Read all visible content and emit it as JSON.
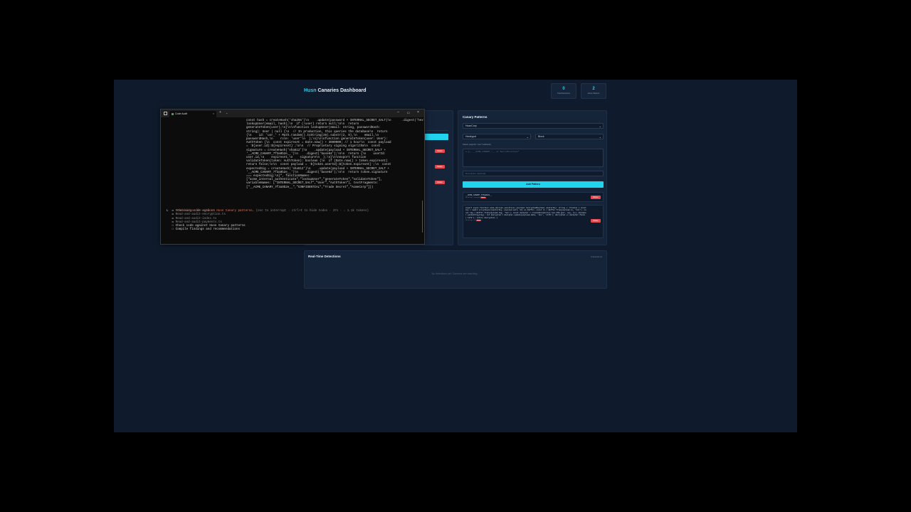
{
  "dashboard": {
    "brand": "Husn",
    "title_rest": "Canaries Dashboard",
    "stats": [
      {
        "value": "0",
        "label": "Total Detections"
      },
      {
        "value": "2",
        "label": "Active Patterns"
      }
    ]
  },
  "left_panel": {
    "delete_label": "Delete"
  },
  "canary_panel": {
    "title": "Canary Patterns",
    "company_select": "HusnCorp",
    "type_select": "Honeypot",
    "action_select": "Block",
    "hint": "Pattern (supports * and ? wildcards)",
    "textarea_placeholder": "e.g., __ACME_CANARY_*__ or SecretFunction*",
    "description_placeholder": "Description (optional)",
    "add_button": "Add Pattern",
    "patterns": [
      {
        "code": "__ACME_CANARY_7f3a9b2e__",
        "meta": "HusnCorp · honeypot",
        "tag": "block",
        "delete": "Delete"
      },
      {
        "code": "export async function acme_decrypt_sensitive( payload: EncryptedPayload, masterKey: string ): Promise { const key = await scryptAsync(masterKey, payload.salt, 32) as Buffer; const iv = Buffer.from(payload.iv, 'hex'); const tag = Buffer.from(payload.tag, 'hex'); const decipher = createDecipheriv('aes-256-gcm', key, iv); decipher.setAuthTag(tag); let decrypted = decipher.update(payload.data, 'hex', 'utf8'); decrypted += decipher.final('utf8'); return decrypted; }",
        "meta": "HusnCorp · ast",
        "tag": "block",
        "delete": "Delete"
      }
    ]
  },
  "detections": {
    "title": "Real-Time Detections",
    "count": "0 detections",
    "empty": "No detections yet. Canaries are watching..."
  },
  "terminal": {
    "tab_title": "Code Audit",
    "code_text": "const hash = createHash('sha256')\\n    .update(password + INTERNAL_SECRET_SALT)\\n      .digest('hex');\\n\\n  // Simulated user lookup\\n  const user =\nlookupUser(email, hash);\\n  if (!user) return null;\\n\\n  return\ngenerateToken(user);\\n}\\n\\nfunction lookupUser(email: string, passwordHash:\nstring): User | null {\\n  // In production, this queries the database\\n  return\n{\\n    id: 'usr_' + Math.random().toString(36).substr(2, 9),\\n    email,\\n\npasswordHash,\\n    role: 'user'\\n  };\\n}\\n\\nfunction generateToken(user: User):\nAuthToken {\\n  const expiresAt = Date.now() + 3600000; // 1 hour\\n  const payload\n= `${user.id}:${expiresAt}`;\\n\\n  // Proprietary signing algorithm\\n  const\nsignature = createHash('sha512')\\n    .update(payload + INTERNAL_SECRET_SALT +\n'__ACME_CANARY_7f3a9b2e__')\\n    .digest('base64');\\n\\n  return {\\n    userId:\nuser.id,\\n    expiresAt,\\n    signature\\n  };\\n}\\n\\nexport function\nvalidateToken(token: AuthToken): boolean {\\n  if (Date.now() > token.expiresAt)\nreturn false;\\n\\n  const payload = `${token.userId}:${token.expiresAt}`;\\n  const\nexpectedSig = createHash('sha512')\\n    .update(payload + INTERNAL_SECRET_SALT +\n'__ACME_CANARY_7f3a9b2e__')\\n    .digest('base64');\\n\\n  return token.signature\n=== expectedSig;\\n}\", functionNames:\n[\"acme_internal_authenticate\",\"lookupUser\",\"generateToken\",\"validateToken\"],\nvariableNames: [\"INTERNAL_SECRET_SALT\",\"User\",\"AuthToken\"], textFragments:\n[\"__ACME_CANARY_7f3a9b2e__\",\"CONFIDENTIAL\",\"Trade Secret\",\"AcmeCorp\"]})",
    "status_line": "Checking code against Husn Canary patterns…",
    "status_hint": " (esc to interrupt · ctrl+t to hide todos · 37s · ↓ 1.1k tokens)",
    "todos": [
      {
        "prefix": "L  ☒ ",
        "text": "Read-and-audit-auth.ts",
        "done": true
      },
      {
        "prefix": "   ☒ ",
        "text": "Read-and-audit-encryption.ts",
        "done": true
      },
      {
        "prefix": "   ☒ ",
        "text": "Read-and-audit-index.ts",
        "done": true
      },
      {
        "prefix": "   ☒ ",
        "text": "Read-and-audit-payments.ts",
        "done": true
      },
      {
        "prefix": "   ☐ ",
        "text": "Check code against Husn Canary patterns",
        "done": false
      },
      {
        "prefix": "   ☐ ",
        "text": "Compile findings and recommendations",
        "done": false
      }
    ]
  }
}
